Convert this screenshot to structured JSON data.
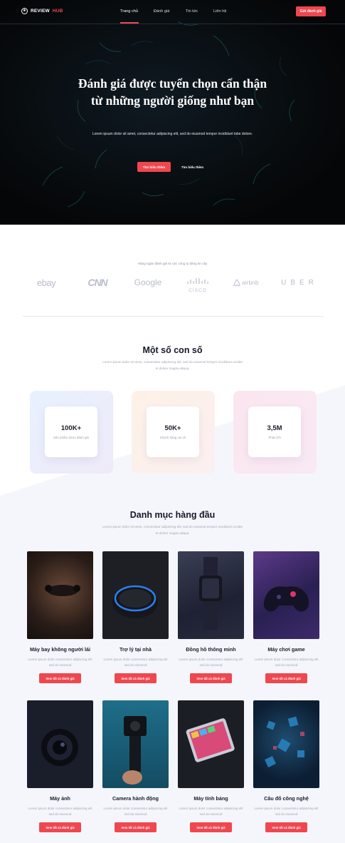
{
  "header": {
    "logo_text": "REVIEW",
    "logo_accent": "HUB",
    "nav": [
      "Trang chủ",
      "Đánh giá",
      "Tin tức",
      "Liên hệ"
    ],
    "cta_label": "Gửi đánh giá"
  },
  "hero": {
    "title": "Đánh giá được tuyển chọn cẩn thận từ những người giống như bạn",
    "text": "Lorem ipsum dolor sit amet, consectetur adipiscing elit, sed do eiusmod tempor incididunt labe dolore.",
    "primary_button": "Tìm hiểu thêm",
    "secondary_button": "Tìm hiểu thêm"
  },
  "trusted": {
    "title": "Hàng ngàn đánh giá từ các công ty đáng tin cậy",
    "brands": [
      "ebay",
      "CNN",
      "Google",
      "CISCO",
      "airbnb",
      "UBER"
    ]
  },
  "stats": {
    "title": "Một số con số",
    "text": "Lorem ipsum dolor sit amet, consectetur adipiscing elit, sed do eiusmod tempor incididunt ut labe et dolore magna aliqua.",
    "items": [
      {
        "value": "100K+",
        "label": "Sản phẩm được đánh giá"
      },
      {
        "value": "50K+",
        "label": "Khách hàng vui vẻ"
      },
      {
        "value": "3,5M",
        "label": "Phản hồi"
      }
    ]
  },
  "categories": {
    "title": "Danh mục hàng đầu",
    "text": "Lorem ipsum dolor sit amet, consectetur adipiscing elit, sed do eiusmod tempor incididunt ut labe et dolore magna aliqua.",
    "button_label": "Xem tất cả đánh giá",
    "items": [
      {
        "name": "Máy bay không người lái",
        "desc": "Lorem ipsum dolor consectetur adipiscing elit sed do eiusmod"
      },
      {
        "name": "Trợ lý tại nhà",
        "desc": "Lorem ipsum dolor consectetur adipiscing elit sed do eiusmod"
      },
      {
        "name": "Đồng hồ thông minh",
        "desc": "Lorem ipsum dolor consectetur adipiscing elit sed do eiusmod"
      },
      {
        "name": "Máy chơi game",
        "desc": "Lorem ipsum dolor consectetur adipiscing elit sed do eiusmod"
      },
      {
        "name": "Máy ảnh",
        "desc": "Lorem ipsum dolor consectetur adipiscing elit sed do eiusmod"
      },
      {
        "name": "Camera hành động",
        "desc": "Lorem ipsum dolor consectetur adipiscing elit sed do eiusmod"
      },
      {
        "name": "Máy tính bảng",
        "desc": "Lorem ipsum dolor consectetur adipiscing elit sed do eiusmod"
      },
      {
        "name": "Câu đố công nghệ",
        "desc": "Lorem ipsum dolor consectetur adipiscing elit sed do eiusmod"
      }
    ]
  },
  "colors": {
    "accent": "#f0474f",
    "dark": "#08090d",
    "text": "#1b1d2e",
    "muted": "#a3a6b6"
  }
}
